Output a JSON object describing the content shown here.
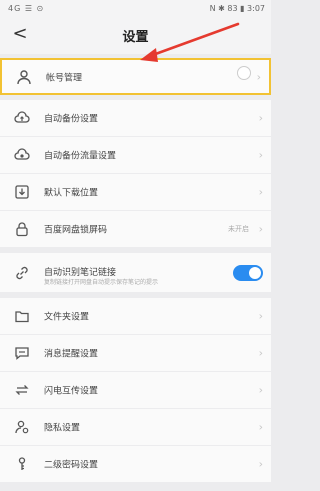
{
  "status": {
    "left": "4G ☰ ⊙",
    "right": "N ✱ 83 ▮ 3:07"
  },
  "nav": {
    "back_glyph": "<",
    "title": "设置"
  },
  "items": [
    {
      "label": "帐号管理",
      "icon": "person-icon"
    },
    {
      "label": "自动备份设置",
      "icon": "cloud-upload-icon"
    },
    {
      "label": "自动备份流量设置",
      "icon": "cloud-sync-icon"
    },
    {
      "label": "默认下载位置",
      "icon": "download-icon"
    },
    {
      "label": "百度网盘锁屏码",
      "icon": "lock-icon",
      "value": "未开启"
    },
    {
      "label": "自动识别笔记链接",
      "icon": "link-icon",
      "sub": "复制链接打开网盘自动提示保存笔记的提示",
      "toggle_on": true
    },
    {
      "label": "文件夹设置",
      "icon": "folder-icon"
    },
    {
      "label": "消息提醒设置",
      "icon": "message-icon"
    },
    {
      "label": "闪电互传设置",
      "icon": "transfer-icon"
    },
    {
      "label": "隐私设置",
      "icon": "privacy-icon"
    },
    {
      "label": "二级密码设置",
      "icon": "key-icon"
    }
  ],
  "colors": {
    "highlight": "#f2c233",
    "arrow": "#e53a2f",
    "toggle": "#2a8cf0"
  }
}
